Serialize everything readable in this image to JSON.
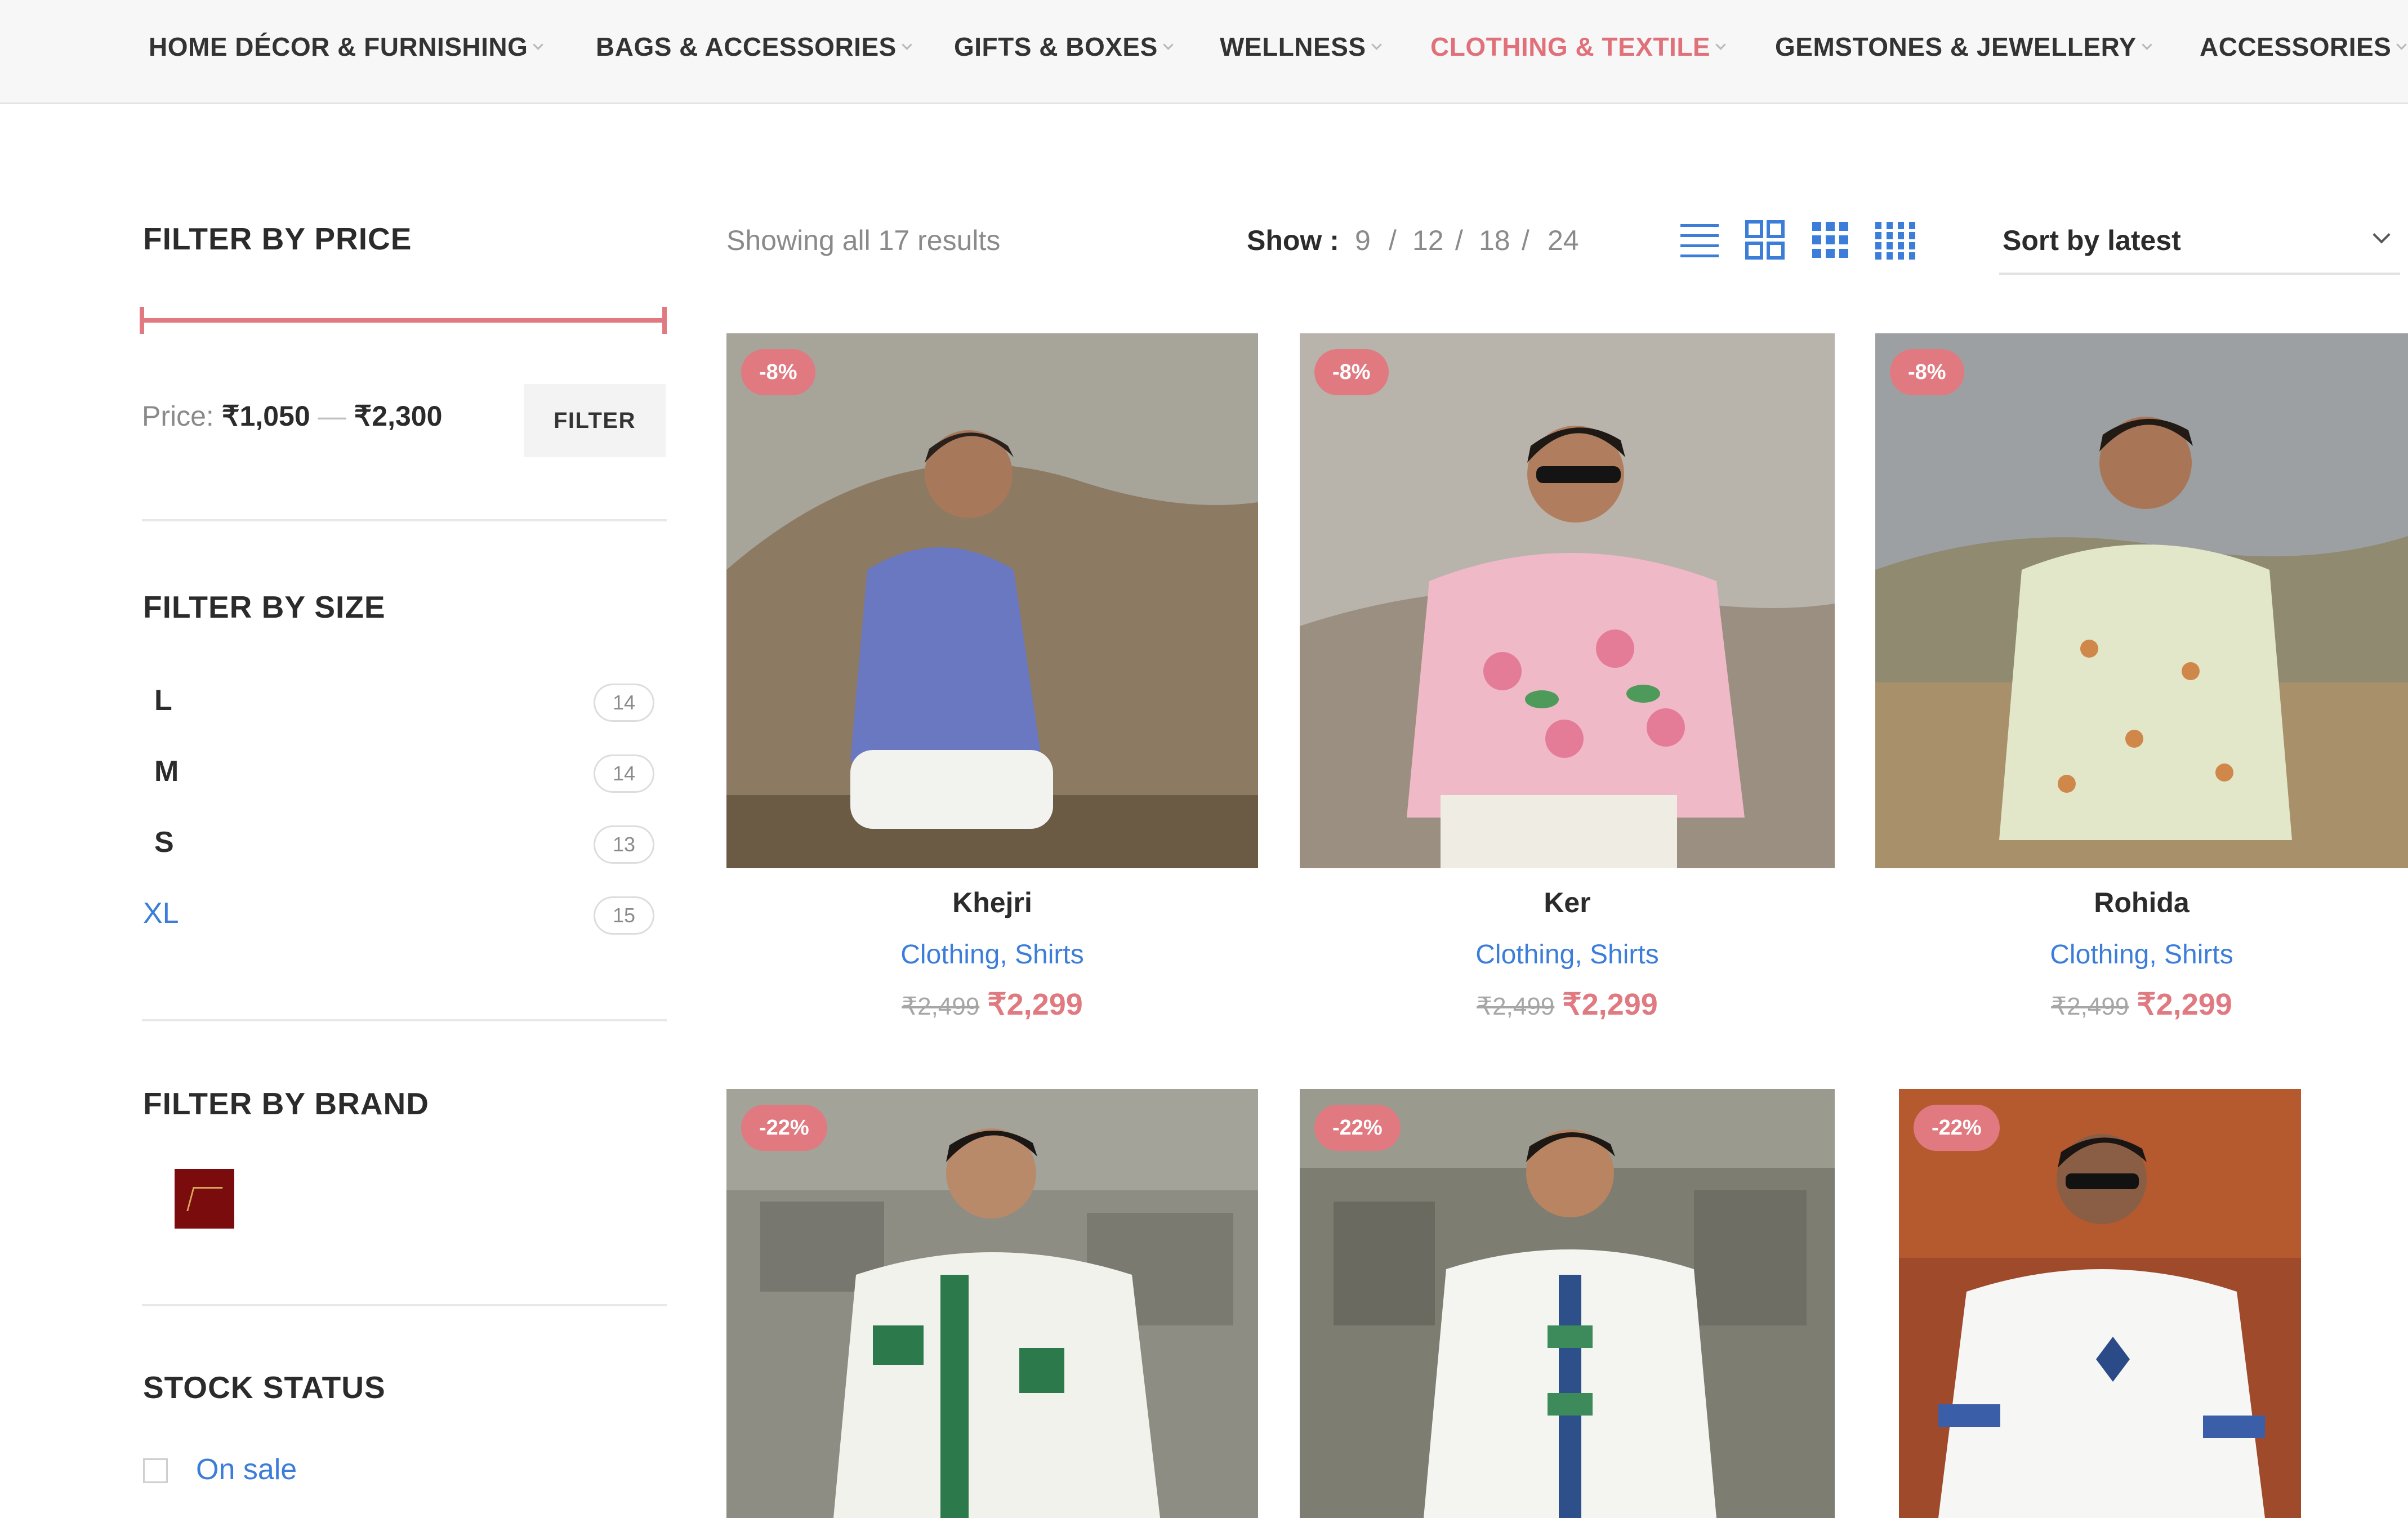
{
  "nav": {
    "items": [
      {
        "label": "HOME DÉCOR & FURNISHING",
        "active": false
      },
      {
        "label": "BAGS & ACCESSORIES",
        "active": false
      },
      {
        "label": "GIFTS & BOXES",
        "active": false
      },
      {
        "label": "WELLNESS",
        "active": false
      },
      {
        "label": "CLOTHING & TEXTILE",
        "active": true
      },
      {
        "label": "GEMSTONES & JEWELLERY",
        "active": false
      },
      {
        "label": "ACCESSORIES",
        "active": false
      }
    ]
  },
  "sidebar": {
    "price": {
      "title": "FILTER BY PRICE",
      "label": "Price:",
      "min": "₹1,050",
      "separator": "—",
      "max": "₹2,300",
      "button": "FILTER"
    },
    "size": {
      "title": "FILTER BY SIZE",
      "items": [
        {
          "name": "L",
          "count": "14"
        },
        {
          "name": "M",
          "count": "14"
        },
        {
          "name": "S",
          "count": "13"
        },
        {
          "name": "XL",
          "count": "15"
        }
      ]
    },
    "brand": {
      "title": "FILTER BY BRAND",
      "logo_icon": "brand-logo-icon"
    },
    "stock": {
      "title": "STOCK STATUS",
      "option": "On sale"
    }
  },
  "toolbar": {
    "results": "Showing all 17 results",
    "show_label": "Show :",
    "show_options": [
      "9",
      "12",
      "18",
      "24"
    ],
    "show_separator": "/",
    "view_icons": [
      "list-view-icon",
      "grid-2-icon",
      "grid-3-icon",
      "grid-4-icon"
    ],
    "sort_label": "Sort by latest"
  },
  "products": [
    {
      "name": "Khejri",
      "badge": "-8%",
      "categories": [
        "Clothing",
        "Shirts"
      ],
      "old_price": "₹2,499",
      "price": "₹2,299",
      "shirt_color": "#6a78c2",
      "bg": "#8c7a63"
    },
    {
      "name": "Ker",
      "badge": "-8%",
      "categories": [
        "Clothing",
        "Shirts"
      ],
      "old_price": "₹2,499",
      "price": "₹2,299",
      "shirt_color": "#efb9c7",
      "bg": "#9a8f80"
    },
    {
      "name": "Rohida",
      "badge": "-8%",
      "categories": [
        "Clothing",
        "Shirts"
      ],
      "old_price": "₹2,499",
      "price": "₹2,299",
      "shirt_color": "#e2e7c9",
      "bg": "#8f8a70"
    },
    {
      "name": "",
      "badge": "-22%",
      "categories": [],
      "old_price": "",
      "price": "",
      "shirt_color": "#f2f2ec",
      "bg": "#8d8d84"
    },
    {
      "name": "",
      "badge": "-22%",
      "categories": [],
      "old_price": "",
      "price": "",
      "shirt_color": "#f4f4f0",
      "bg": "#7e7d72"
    },
    {
      "name": "",
      "badge": "-22%",
      "categories": [],
      "old_price": "",
      "price": "",
      "shirt_color": "#f6f6f4",
      "bg": "#a04a2c"
    }
  ],
  "colors": {
    "accent": "#e07a80",
    "link": "#3b7dd8",
    "nav_bg": "#f7f7f7"
  }
}
